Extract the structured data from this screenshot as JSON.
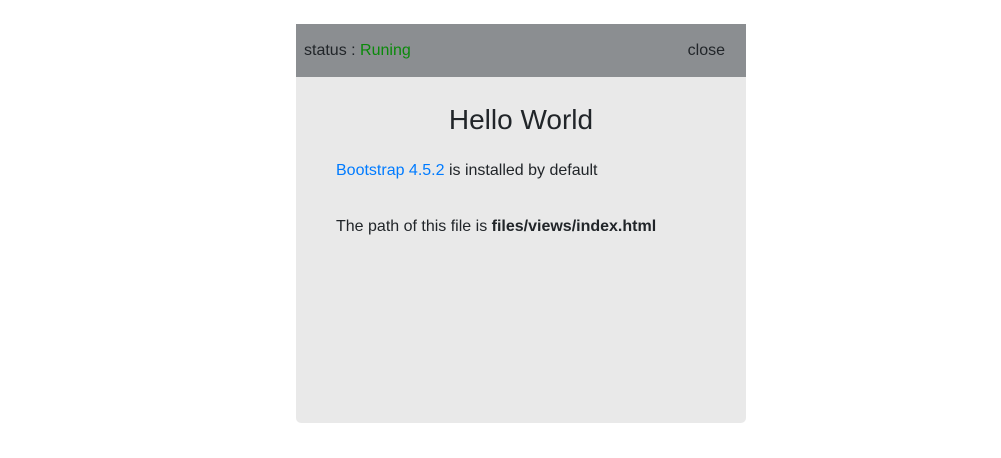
{
  "header": {
    "status_label": "status : ",
    "status_value": "Runing",
    "close_label": "close"
  },
  "main": {
    "title": "Hello World",
    "bootstrap_link": "Bootstrap 4.5.2",
    "bootstrap_text": " is installed by default",
    "path_text": "The path of this file is ",
    "path_value": "files/views/index.html"
  },
  "colors": {
    "header_bg": "#8b8e91",
    "body_bg": "#e9e9e9",
    "status_running": "#0a8a0a",
    "link": "#007bff"
  }
}
